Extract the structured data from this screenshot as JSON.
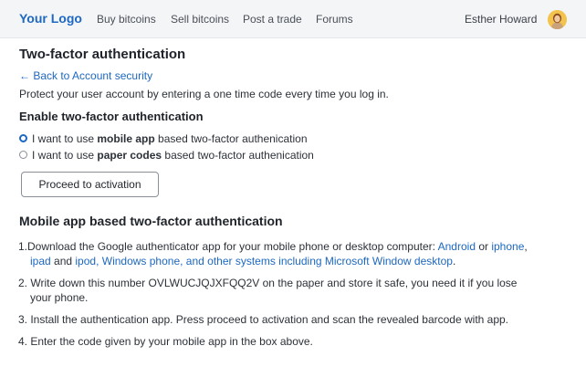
{
  "header": {
    "logo": "Your Logo",
    "nav": [
      "Buy bitcoins",
      "Sell bitcoins",
      "Post a trade",
      "Forums"
    ],
    "user_name": "Esther Howard"
  },
  "page": {
    "title": "Two-factor authentication",
    "back_link": "← Back to Account security",
    "intro": "Protect your user account by entering a one time code every time you log in.",
    "section_title": "Enable two-factor authentication",
    "options": [
      {
        "pre": "I want to use ",
        "bold": "mobile app",
        "post": " based two-factor authenication",
        "selected": true
      },
      {
        "pre": "I want to use ",
        "bold": "paper codes",
        "post": " based two-factor authenication",
        "selected": false
      }
    ],
    "proceed_button": "Proceed to activation"
  },
  "mobile_section": {
    "title": "Mobile app based two-factor authentication",
    "step1": {
      "prefix": "1.Download the Google authenticator app for your mobile phone or desktop computer: ",
      "link_android": "Android",
      "or": " or ",
      "link_iphone": "iphone",
      "comma": ",",
      "link_ipad": "ipad",
      "and": " and ",
      "link_ipod": "ipod, Windows phone, and other systems including Microsoft Window desktop",
      "end": "."
    },
    "step2_line1": "2. Write down this number OVLWUCJQJXFQQ2V on the paper and store it safe, you need it if you lose",
    "step2_line2": "your phone.",
    "step3": "3. Install the authentication app. Press proceed to activation and scan the revealed barcode with app.",
    "step4": "4. Enter the code given by your mobile app in the box above."
  },
  "colors": {
    "accent": "#1d68c0",
    "header_bg": "#f4f5f7",
    "avatar_bg": "#f2c44e"
  },
  "icons": {
    "avatar": "user-avatar"
  }
}
